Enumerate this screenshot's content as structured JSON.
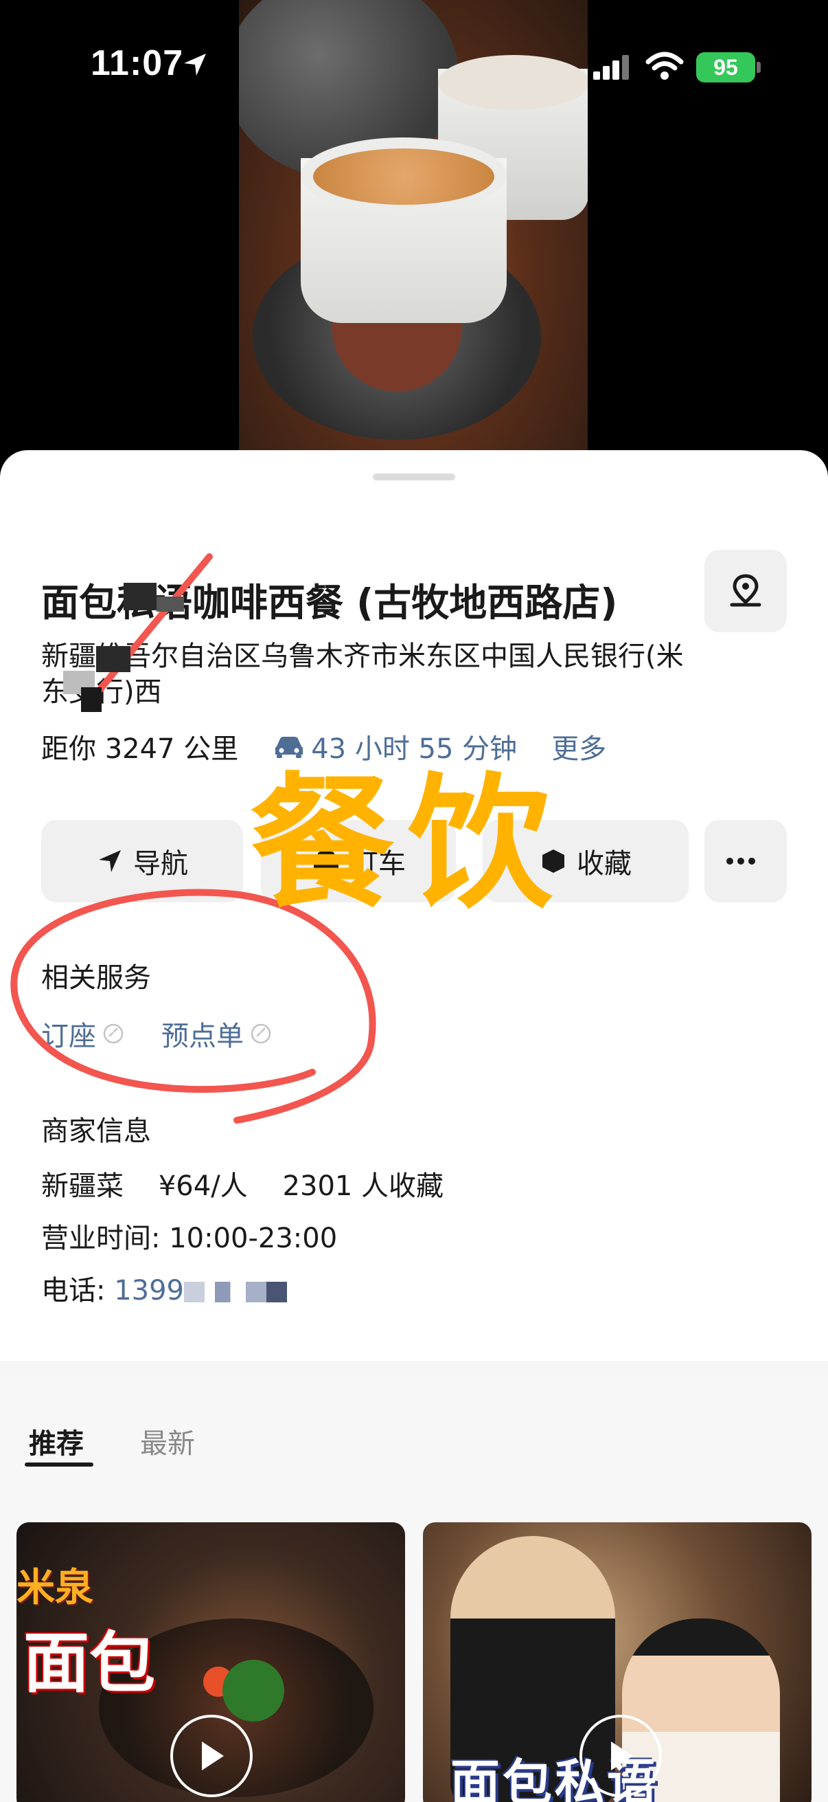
{
  "status_bar": {
    "time": "11:07",
    "battery": "95"
  },
  "restaurant": {
    "title": "面包私语咖啡西餐 (古牧地西路店)",
    "address": "新疆维吾尔自治区乌鲁木齐市米东区中国人民银行(米东支行)西",
    "distance": "距你 3247 公里",
    "drive_time": "43 小时 55 分钟",
    "more": "更多"
  },
  "actions": {
    "navigate": "导航",
    "taxi": "打车",
    "favorite": "收藏"
  },
  "related_services": {
    "title": "相关服务",
    "items": [
      "订座",
      "预点单"
    ]
  },
  "merchant_info": {
    "title": "商家信息",
    "cuisine_line": "新疆菜    ¥64/人    2301 人收藏",
    "hours_line": "营业时间: 10:00-23:00",
    "phone_label": "电话: ",
    "phone_value": "1399"
  },
  "feed": {
    "tabs": [
      "推荐",
      "最新"
    ],
    "card_a_tag": "米泉",
    "card_a_big": "面包",
    "card_b_caption": "面包私语"
  },
  "annotation": {
    "label": "餐饮",
    "circle_color": "#f2564f",
    "label_color": "#ffb300"
  },
  "colors": {
    "link": "#4e6e96",
    "battery": "#34c759"
  }
}
